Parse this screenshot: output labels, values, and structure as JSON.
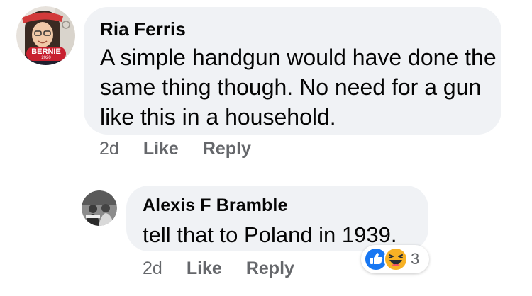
{
  "comments": [
    {
      "author": "Ria Ferris",
      "avatar_badge": "BERNIE",
      "avatar_badge_sub": "2020",
      "text": "A simple handgun would have done the same thing though. No need for a gun like this in a household.",
      "time": "2d",
      "like_label": "Like",
      "reply_label": "Reply"
    },
    {
      "author": "Alexis F Bramble",
      "text": "tell that to Poland in 1939.",
      "time": "2d",
      "like_label": "Like",
      "reply_label": "Reply",
      "reactions": {
        "icons": [
          "like-icon",
          "haha-icon"
        ],
        "count": "3"
      }
    }
  ],
  "colors": {
    "bubble": "#f0f2f5",
    "meta_text": "#65676b",
    "like_blue": "#1877f2",
    "haha_yellow": "#f7b125",
    "badge_red": "#c8202f"
  }
}
